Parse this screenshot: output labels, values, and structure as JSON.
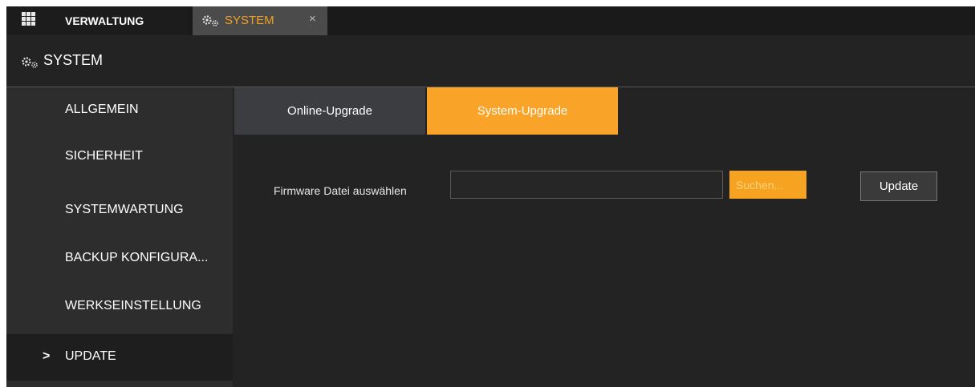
{
  "topbar": {
    "home_label": "VERWALTUNG",
    "active_tab_label": "SYSTEM",
    "close_glyph": "×"
  },
  "section": {
    "title": "SYSTEM"
  },
  "sidebar": {
    "items": [
      {
        "label": "ALLGEMEIN"
      },
      {
        "label": "SICHERHEIT"
      },
      {
        "label": "SYSTEMWARTUNG"
      },
      {
        "label": "BACKUP KONFIGURA..."
      },
      {
        "label": "WERKSEINSTELLUNG"
      },
      {
        "label": "UPDATE",
        "active": true,
        "indicator": ">"
      }
    ]
  },
  "main": {
    "tabs": [
      {
        "label": "Online-Upgrade"
      },
      {
        "label": "System-Upgrade",
        "active": true
      }
    ],
    "firmware_label": "Firmware Datei auswählen",
    "firmware_value": "",
    "search_label": "Suchen...",
    "update_label": "Update"
  },
  "colors": {
    "accent": "#f9a328",
    "background": "#232323",
    "sidebar": "#2d2d2d",
    "topbar": "#1a1a1a"
  },
  "icons": {
    "home": "grid-icon",
    "tab": "gears-icon",
    "section": "gears-icon",
    "close": "close-icon"
  }
}
